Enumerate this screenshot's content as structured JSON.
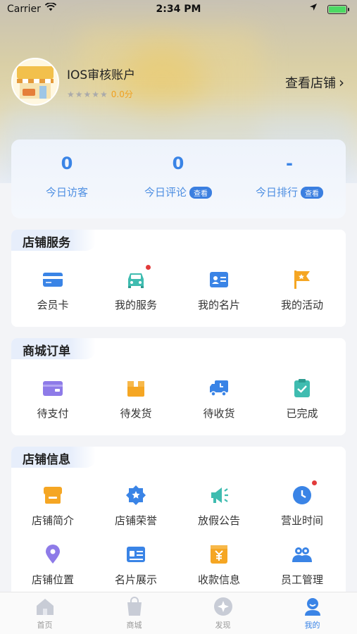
{
  "status_bar": {
    "carrier": "Carrier",
    "time": "2:34 PM"
  },
  "profile": {
    "store_name": "IOS审核账户",
    "stars": "★★★★★",
    "score": "0.0分",
    "view_store": "查看店铺",
    "view_store_chevron": "›"
  },
  "stats": [
    {
      "value": "0",
      "label": "今日访客",
      "badge": ""
    },
    {
      "value": "0",
      "label": "今日评论",
      "badge": "查看"
    },
    {
      "value": "-",
      "label": "今日排行",
      "badge": "查看"
    }
  ],
  "sections": {
    "store_service": {
      "title": "店铺服务",
      "items": [
        "会员卡",
        "我的服务",
        "我的名片",
        "我的活动"
      ]
    },
    "mall_orders": {
      "title": "商城订单",
      "items": [
        "待支付",
        "待发货",
        "待收货",
        "已完成"
      ]
    },
    "store_info": {
      "title": "店铺信息",
      "items": [
        "店铺简介",
        "店铺荣誉",
        "放假公告",
        "营业时间",
        "店铺位置",
        "名片展示",
        "收款信息",
        "员工管理"
      ]
    }
  },
  "tabbar": {
    "items": [
      "首页",
      "商城",
      "发现",
      "我的"
    ],
    "active_index": 3
  },
  "colors": {
    "accent": "#3a84e6",
    "orange": "#f5a623",
    "teal": "#3fbcb0",
    "purple": "#8e7be8",
    "badge_dot": "#e23b3b"
  }
}
